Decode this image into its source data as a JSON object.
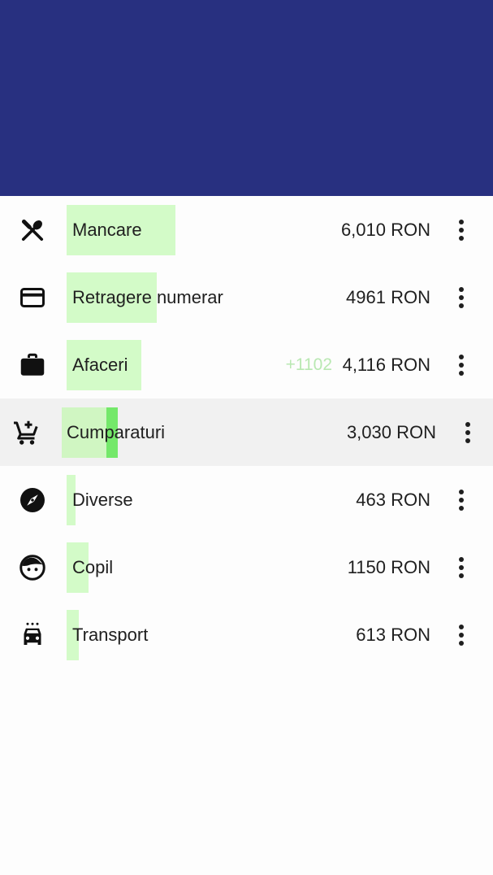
{
  "header": {
    "color": "#283080"
  },
  "colors": {
    "bar": "#d3fbc8",
    "marker": "#74e86a",
    "delta": "#b9e8b2",
    "selected_row": "#f1f1f1"
  },
  "categories": [
    {
      "name": "Mancare",
      "amount": "6,010 RON",
      "icon": "fork-spoon-icon",
      "bar_fraction": 0.22
    },
    {
      "name": "Retragere numerar",
      "amount": "4961 RON",
      "icon": "credit-card-icon",
      "bar_fraction": 0.18
    },
    {
      "name": "Afaceri",
      "delta": "+1102",
      "amount": "4,116 RON",
      "icon": "briefcase-icon",
      "bar_fraction": 0.15
    },
    {
      "name": "Cumparaturi",
      "amount": "3,030 RON",
      "icon": "add-to-cart-icon",
      "bar_fraction": 0.115,
      "selected": true
    },
    {
      "name": "Diverse",
      "amount": "463 RON",
      "icon": "compass-icon",
      "bar_fraction": 0.02
    },
    {
      "name": "Copil",
      "amount": "1150 RON",
      "icon": "child-face-icon",
      "bar_fraction": 0.045
    },
    {
      "name": "Transport",
      "amount": "613 RON",
      "icon": "taxi-icon",
      "bar_fraction": 0.025
    }
  ]
}
